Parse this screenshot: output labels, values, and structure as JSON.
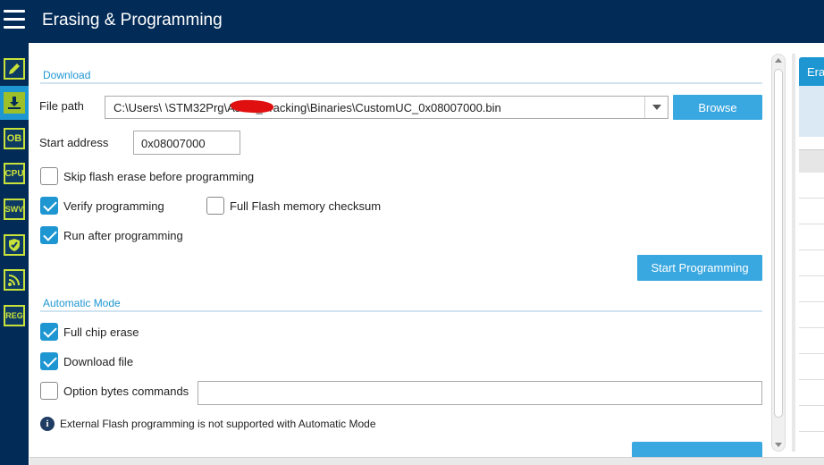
{
  "header": {
    "title": "Erasing & Programming"
  },
  "sidebar": {
    "items": [
      {
        "name": "memory-edit",
        "label": ""
      },
      {
        "name": "erase-program",
        "label": ""
      },
      {
        "name": "option-bytes",
        "label": "OB"
      },
      {
        "name": "cpu",
        "label": "CPU"
      },
      {
        "name": "swv",
        "label": "SWV"
      },
      {
        "name": "security",
        "label": ""
      },
      {
        "name": "wireless",
        "label": ""
      },
      {
        "name": "registers",
        "label": "REG"
      }
    ]
  },
  "download": {
    "section_title": "Download",
    "file_path_label": "File path",
    "file_path_value": "C:\\Users\\          \\STM32Prg\\Asset_Tracking\\Binaries\\CustomUC_0x08007000.bin",
    "browse_label": "Browse",
    "start_address_label": "Start address",
    "start_address_value": "0x08007000",
    "skip_erase_label": "Skip flash erase before programming",
    "skip_erase_checked": false,
    "verify_label": "Verify programming",
    "verify_checked": true,
    "checksum_label": "Full Flash memory checksum",
    "checksum_checked": false,
    "run_after_label": "Run after programming",
    "run_after_checked": true,
    "start_button": "Start Programming"
  },
  "automatic": {
    "section_title": "Automatic Mode",
    "full_erase_label": "Full chip erase",
    "full_erase_checked": true,
    "download_file_label": "Download file",
    "download_file_checked": true,
    "option_bytes_label": "Option bytes commands",
    "option_bytes_checked": false,
    "option_bytes_value": "",
    "info_text": "External Flash programming is not supported with Automatic Mode"
  },
  "right_panel": {
    "tab_label": "Eras"
  },
  "colors": {
    "navy": "#032b57",
    "accent": "#1e96d2",
    "button": "#3aa8e0",
    "icon_green": "#c9e23a"
  }
}
